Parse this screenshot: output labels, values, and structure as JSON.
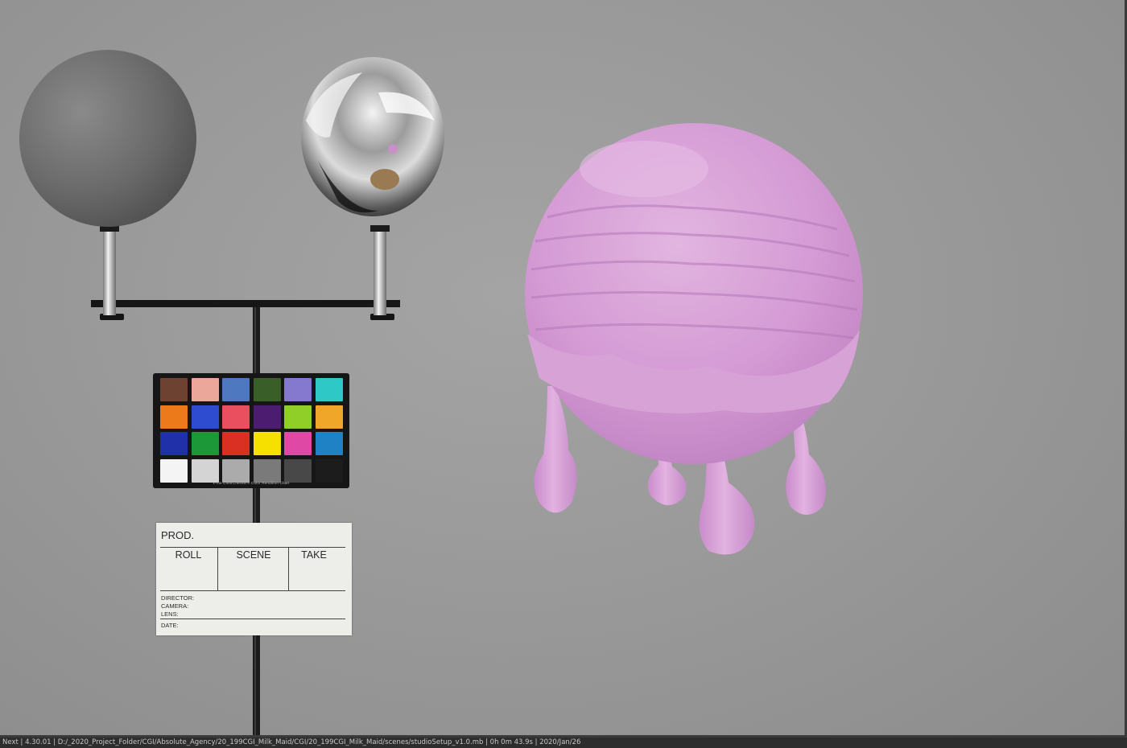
{
  "status_bar": {
    "text": "Next | 4.30.01 | D:/_2020_Project_Folder/CGI/Absolute_Agency/20_199CGI_Milk_Maid/CGI/20_199CGI_Milk_Maid/scenes/studioSetup_v1.0.mb |  0h  0m 43.9s | 2020/Jan/26"
  },
  "color_checker": {
    "caption": "x-rite ColorChecker® Color Rendition Chart",
    "patches": [
      "#6e4230",
      "#eba89a",
      "#4e78c0",
      "#3a5e28",
      "#8478cf",
      "#2ec9c6",
      "#ed7a1a",
      "#2e4cd0",
      "#ea4f60",
      "#4b1c70",
      "#8fcf28",
      "#f0a628",
      "#1f30a8",
      "#1c9838",
      "#da3024",
      "#f5e000",
      "#e048a6",
      "#1e82c4",
      "#f4f4f4",
      "#d4d4d4",
      "#ababab",
      "#7a7a7a",
      "#484848",
      "#1c1c1c"
    ]
  },
  "slate": {
    "prod": "PROD.",
    "roll": "ROLL",
    "scene": "SCENE",
    "take": "TAKE",
    "director": "DIRECTOR:",
    "camera": "CAMERA:",
    "lens": "LENS:",
    "date": "DATE:"
  }
}
